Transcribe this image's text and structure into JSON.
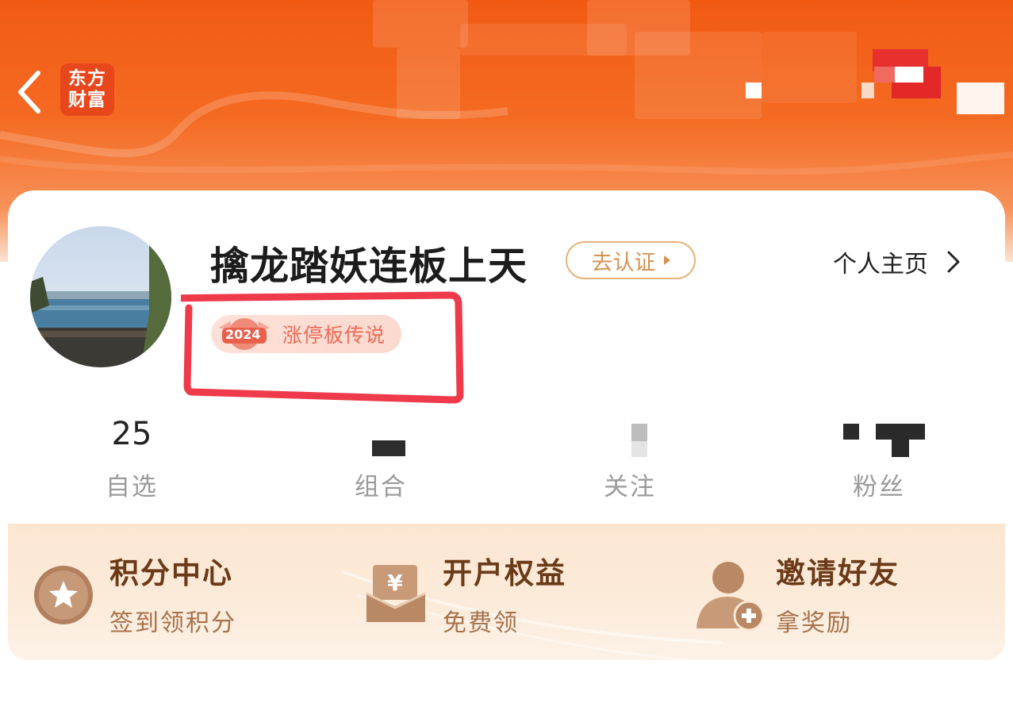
{
  "app": {
    "logo_line1": "东方",
    "logo_line2": "财富"
  },
  "profile": {
    "username": "擒龙踏妖连板上天",
    "verify_label": "去认证",
    "homepage_label": "个人主页",
    "badge_year": "2024",
    "badge_label": "涨停板传说"
  },
  "stats": [
    {
      "value": "25",
      "label": "自选"
    },
    {
      "value": "",
      "label": "组合"
    },
    {
      "value": "",
      "label": "关注"
    },
    {
      "value": "",
      "label": "粉丝"
    }
  ],
  "entries": [
    {
      "title": "积分中心",
      "subtitle": "签到领积分",
      "icon": "star-icon"
    },
    {
      "title": "开户权益",
      "subtitle": "免费领",
      "icon": "yuan-envelope-icon"
    },
    {
      "title": "邀请好友",
      "subtitle": "拿奖励",
      "icon": "add-friend-icon"
    }
  ],
  "colors": {
    "brand": "#f25a12",
    "logo_bg": "#e8471c",
    "verify": "#d69250",
    "badge_text": "#ee6a55",
    "entry_title": "#6b3a18",
    "entry_sub": "#a7714b",
    "annotation": "#ee3a4a"
  }
}
